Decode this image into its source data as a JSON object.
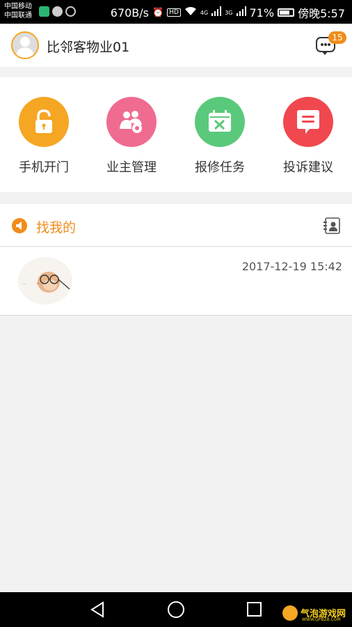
{
  "status_bar": {
    "carrier_1": "中国移动",
    "carrier_2": "中国联通",
    "net_speed": "670B/s",
    "net_4g": "4G",
    "net_3g": "3G",
    "battery": "71%",
    "time": "傍晚5:57"
  },
  "header": {
    "community_name": "比邻客物业01",
    "message_badge": "15"
  },
  "grid": {
    "items": [
      {
        "label": "手机开门",
        "icon": "unlock-icon",
        "color": "#f5a623"
      },
      {
        "label": "业主管理",
        "icon": "owners-icon",
        "color": "#ef6b8f"
      },
      {
        "label": "报修任务",
        "icon": "repair-icon",
        "color": "#5bc97b"
      },
      {
        "label": "投诉建议",
        "icon": "complaint-icon",
        "color": "#f0484e"
      }
    ]
  },
  "section": {
    "title": "找我的"
  },
  "list": {
    "items": [
      {
        "time": "2017-12-19 15:42",
        "image": "bird-with-glasses"
      }
    ]
  },
  "watermark": {
    "text": "气泡游戏网",
    "sub": "WWW.QPBZB.COM"
  },
  "colors": {
    "accent": "#f08c1a"
  }
}
